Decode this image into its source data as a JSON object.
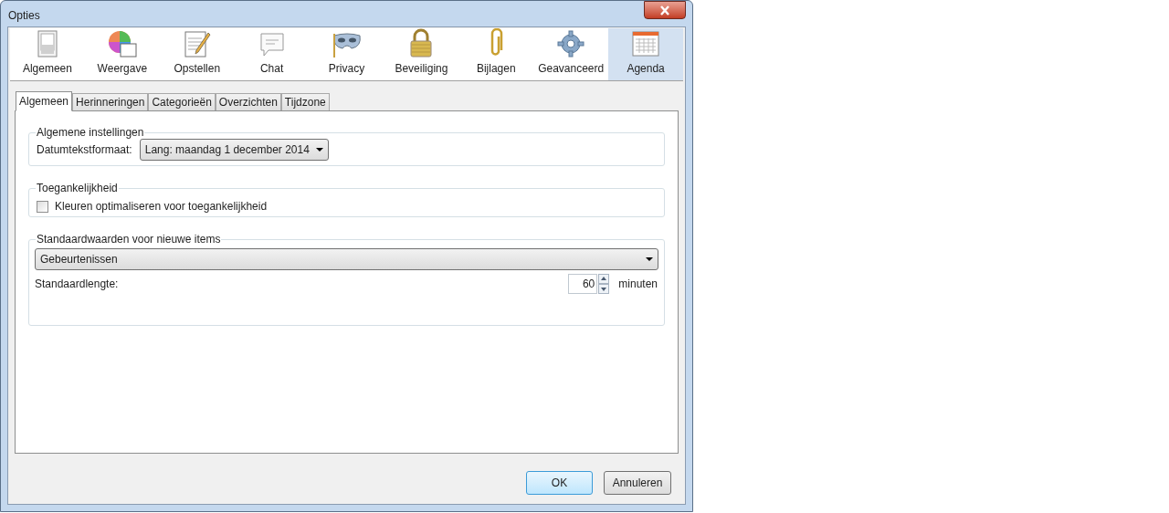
{
  "window": {
    "title": "Opties"
  },
  "toolbar": [
    {
      "label": "Algemeen",
      "selected": false
    },
    {
      "label": "Weergave",
      "selected": false
    },
    {
      "label": "Opstellen",
      "selected": false
    },
    {
      "label": "Chat",
      "selected": false
    },
    {
      "label": "Privacy",
      "selected": false
    },
    {
      "label": "Beveiliging",
      "selected": false
    },
    {
      "label": "Bijlagen",
      "selected": false
    },
    {
      "label": "Geavanceerd",
      "selected": false
    },
    {
      "label": "Agenda",
      "selected": true
    }
  ],
  "tabs": [
    {
      "label": "Algemeen",
      "selected": true
    },
    {
      "label": "Herinneringen",
      "selected": false
    },
    {
      "label": "Categorieën",
      "selected": false
    },
    {
      "label": "Overzichten",
      "selected": false
    },
    {
      "label": "Tijdzone",
      "selected": false
    }
  ],
  "general": {
    "legend": "Algemene instellingen",
    "date_format_label": "Datumtekstformaat:",
    "date_format_value": "Lang: maandag 1 december 2014"
  },
  "accessibility": {
    "legend": "Toegankelijkheid",
    "checkbox": {
      "label": "Kleuren optimaliseren voor toegankelijkheid",
      "checked": false
    }
  },
  "defaults": {
    "legend": "Standaardwaarden voor nieuwe items",
    "item_type": "Gebeurtenissen",
    "length_label": "Standaardlengte:",
    "length_value": "60",
    "length_unit": "minuten"
  },
  "buttons": [
    "OK",
    "Annuleren"
  ]
}
